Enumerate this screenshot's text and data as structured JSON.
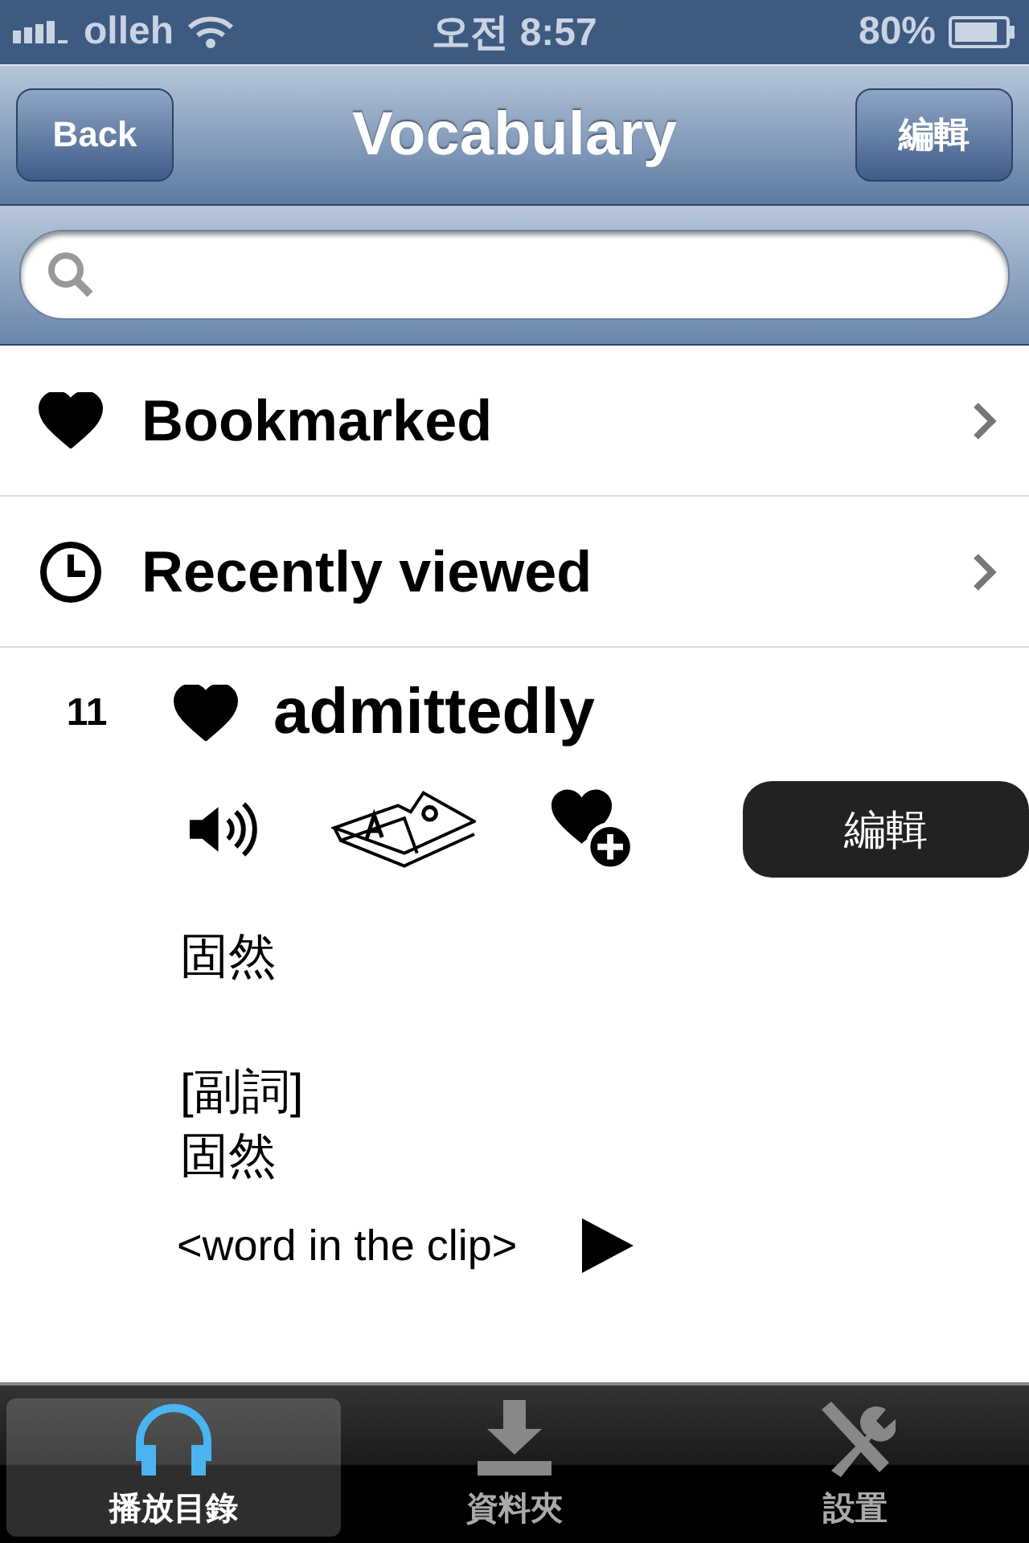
{
  "status_bar": {
    "carrier": "olleh",
    "time": "오전 8:57",
    "battery": "80%"
  },
  "nav": {
    "back": "Back",
    "title": "Vocabulary",
    "action": "編輯"
  },
  "menu": [
    {
      "label": "Bookmarked",
      "kind": "bookmark"
    },
    {
      "label": "Recently viewed",
      "kind": "history"
    }
  ],
  "entry": {
    "number": "11",
    "word": "admittedly",
    "bookmarked": true,
    "edit_button": "編輯",
    "meaning": "固然",
    "part_of_speech": "[副詞]",
    "pos_meaning": "固然",
    "clip_label": "<word in the clip>"
  },
  "tabs": [
    {
      "label": "播放目錄",
      "kind": "headphones",
      "selected": true
    },
    {
      "label": "資料夾",
      "kind": "download",
      "selected": false
    },
    {
      "label": "設置",
      "kind": "tools",
      "selected": false
    }
  ]
}
